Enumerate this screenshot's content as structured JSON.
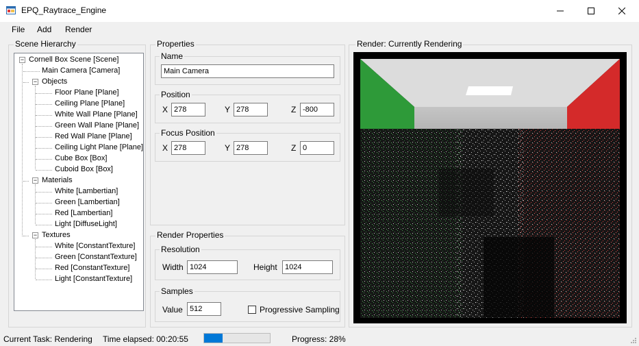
{
  "window": {
    "title": "EPQ_Raytrace_Engine",
    "icon": "app-window-icon",
    "controls": [
      "minimize-icon",
      "maximize-icon",
      "close-icon"
    ]
  },
  "menu": {
    "file": "File",
    "add": "Add",
    "render": "Render"
  },
  "scene_hierarchy": {
    "label": "Scene Hierarchy",
    "root": "Cornell Box Scene [Scene]",
    "camera": "Main Camera [Camera]",
    "objects_label": "Objects",
    "objects": [
      "Floor Plane [Plane]",
      "Ceiling Plane [Plane]",
      "White Wall Plane [Plane]",
      "Green Wall Plane [Plane]",
      "Red Wall Plane [Plane]",
      "Ceiling Light Plane [Plane]",
      "Cube Box [Box]",
      "Cuboid Box [Box]"
    ],
    "materials_label": "Materials",
    "materials": [
      "White [Lambertian]",
      "Green [Lambertian]",
      "Red [Lambertian]",
      "Light [DiffuseLight]"
    ],
    "textures_label": "Textures",
    "textures": [
      "White [ConstantTexture]",
      "Green [ConstantTexture]",
      "Red [ConstantTexture]",
      "Light [ConstantTexture]"
    ]
  },
  "properties": {
    "label": "Properties",
    "name_label": "Name",
    "name_value": "Main Camera",
    "position_label": "Position",
    "position": {
      "x_label": "X",
      "x": "278",
      "y_label": "Y",
      "y": "278",
      "z_label": "Z",
      "z": "-800"
    },
    "focus_label": "Focus Position",
    "focus": {
      "x_label": "X",
      "x": "278",
      "y_label": "Y",
      "y": "278",
      "z_label": "Z",
      "z": "0"
    }
  },
  "render_properties": {
    "label": "Render Properties",
    "resolution_label": "Resolution",
    "width_label": "Width",
    "width": "1024",
    "height_label": "Height",
    "height": "1024",
    "samples_label": "Samples",
    "value_label": "Value",
    "value": "512",
    "progressive_label": "Progressive Sampling",
    "progressive_checked": false
  },
  "render": {
    "label": "Render: Currently Rendering"
  },
  "status": {
    "task": "Current Task: Rendering",
    "elapsed": "Time elapsed: 00:20:55",
    "progress_fraction": 0.28,
    "progress_text": "Progress: 28%"
  },
  "colors": {
    "accent": "#0078d7",
    "green_wall": "#2e9a39",
    "red_wall": "#d42a2a"
  }
}
